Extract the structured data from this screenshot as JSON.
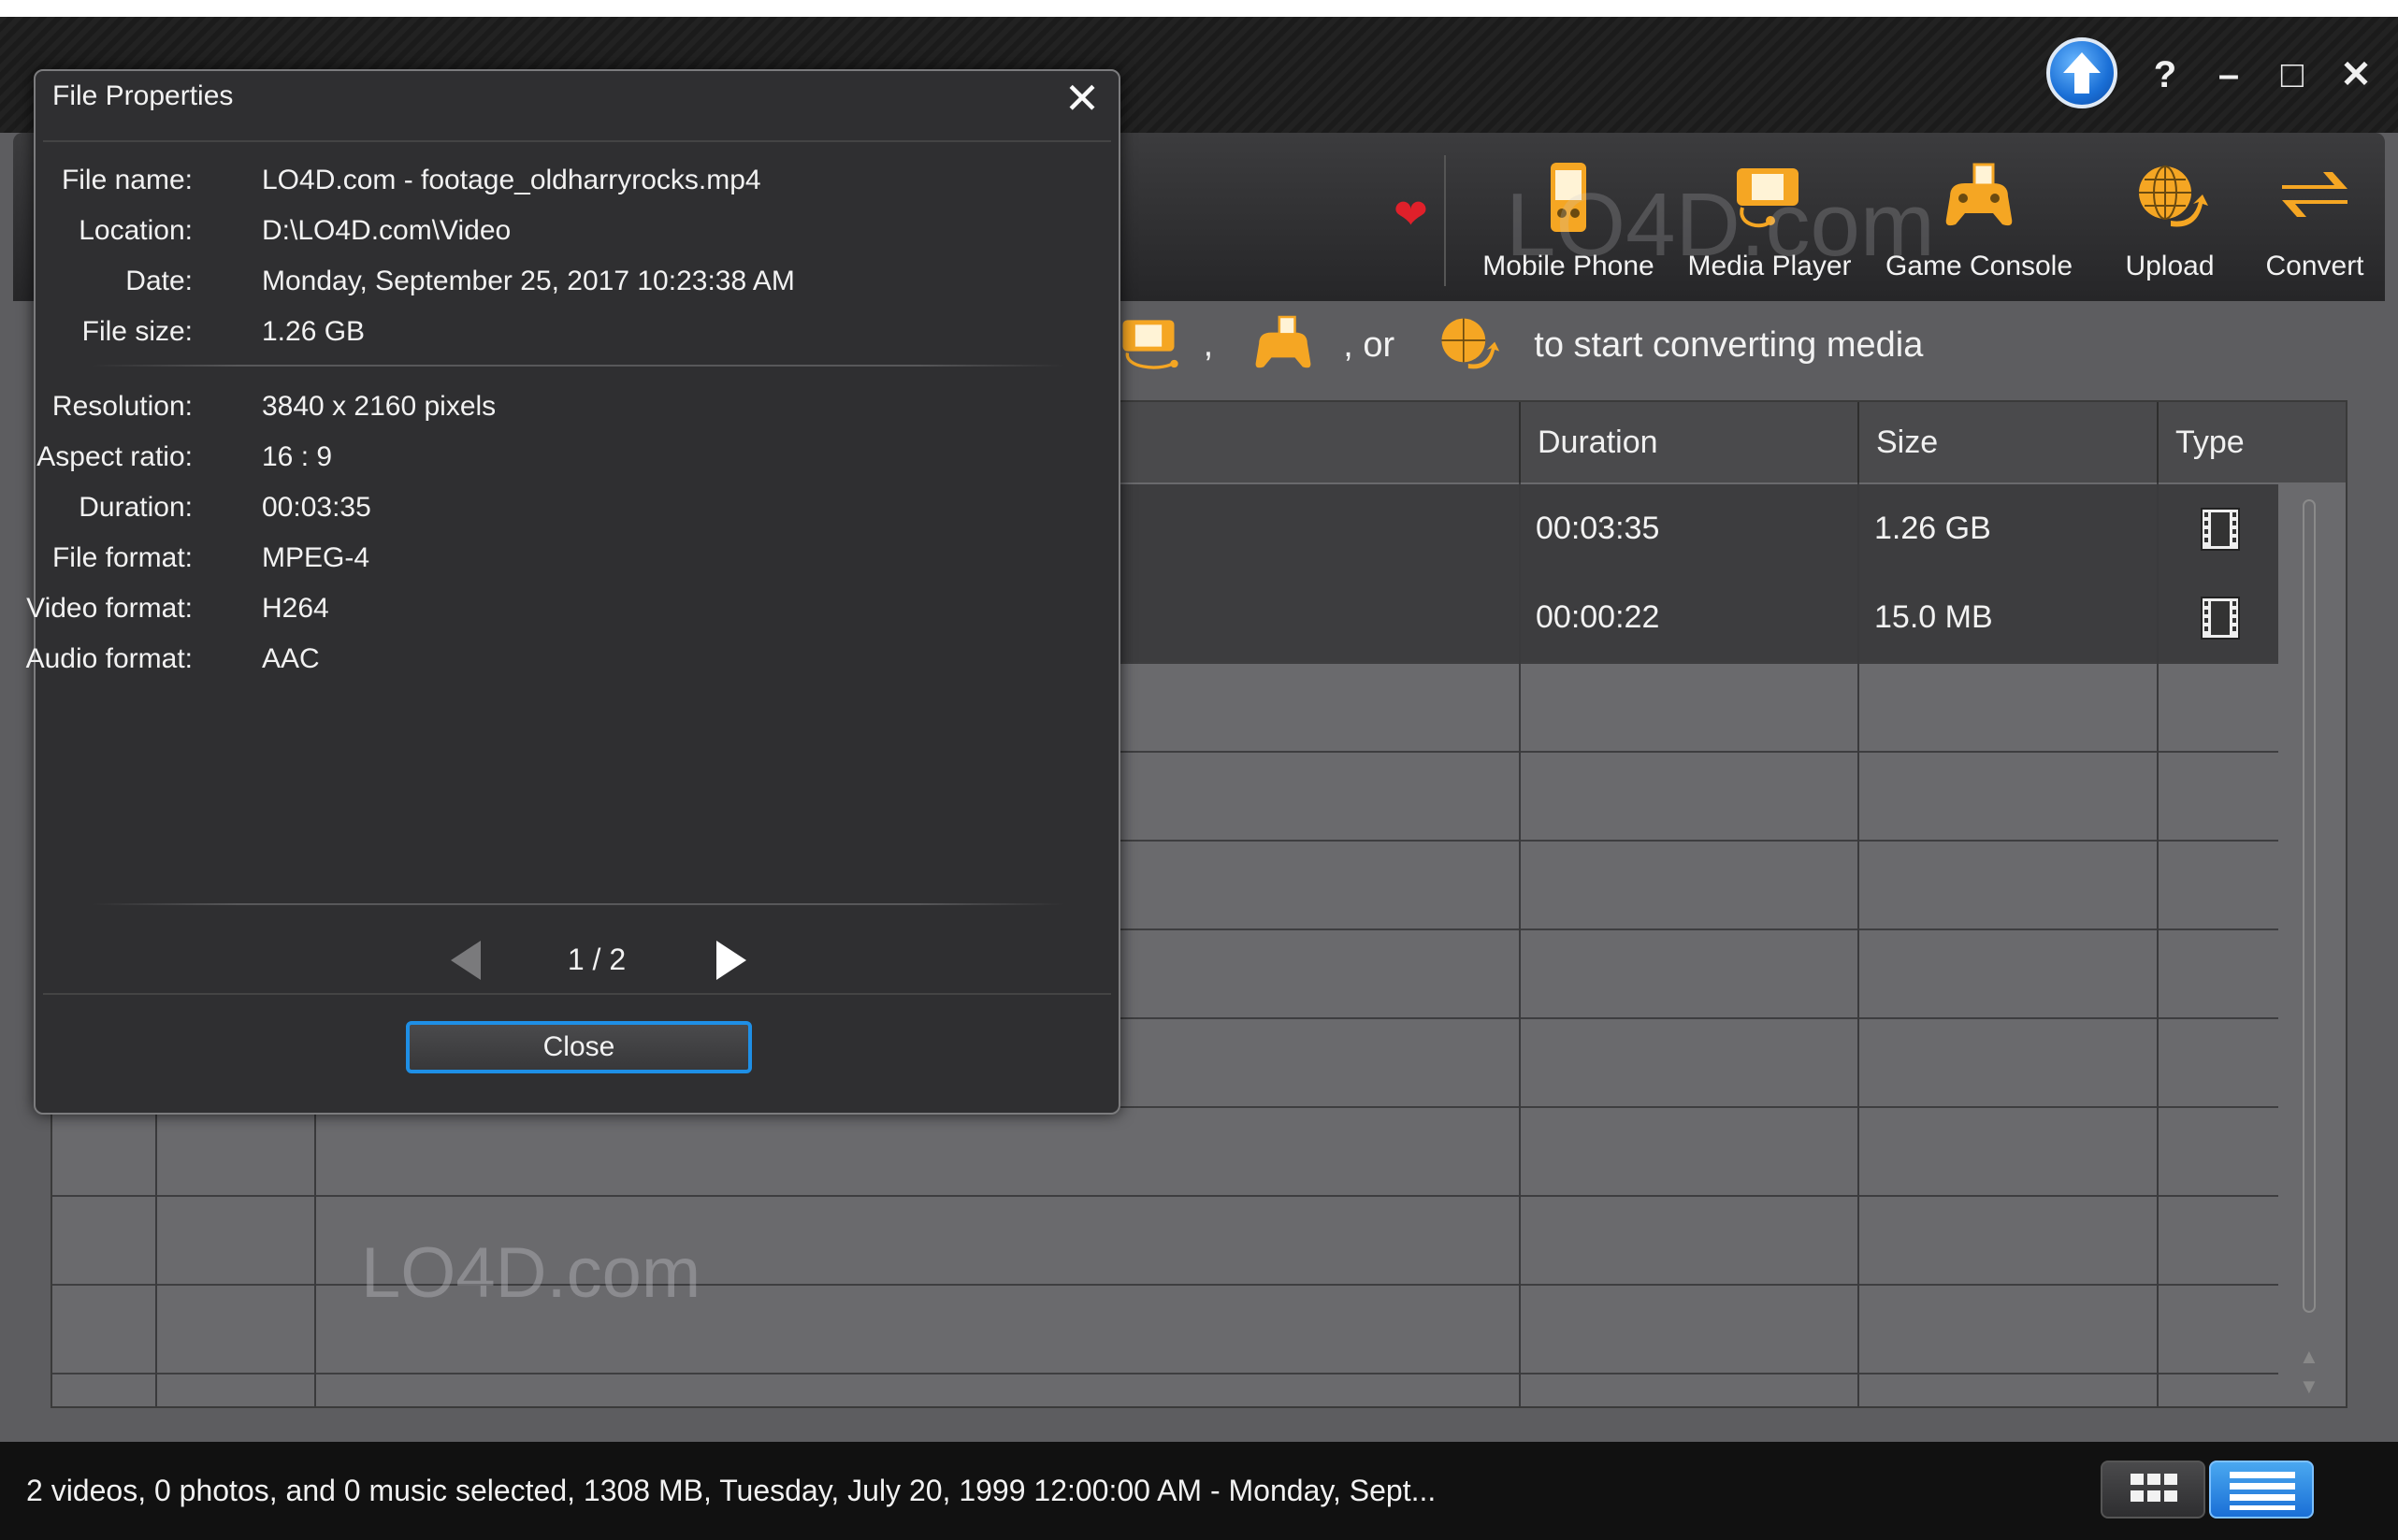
{
  "window": {
    "controls": {
      "help": "?",
      "minimize": "–",
      "maximize": "□",
      "close": "✕"
    }
  },
  "toolbar": {
    "items": [
      {
        "label": "Mobile Phone",
        "icon": "mobile-phone-icon"
      },
      {
        "label": "Media Player",
        "icon": "media-player-icon"
      },
      {
        "label": "Game Console",
        "icon": "game-console-icon"
      },
      {
        "label": "Upload",
        "icon": "upload-globe-icon"
      },
      {
        "label": "Convert",
        "icon": "convert-arrows-icon"
      }
    ],
    "favorite_icon": "heart-icon"
  },
  "hint": {
    "comma": ",",
    "or": ", or",
    "text": "to start converting media"
  },
  "table": {
    "columns": [
      "Duration",
      "Size",
      "Type"
    ],
    "rows": [
      {
        "duration": "00:03:35",
        "size": "1.26 GB",
        "type_icon": "film-strip-icon"
      },
      {
        "duration": "00:00:22",
        "size": "15.0 MB",
        "type_icon": "film-strip-icon"
      }
    ]
  },
  "watermark": "LO4D.com",
  "status": {
    "text": "2 videos, 0 photos, and 0 music selected, 1308 MB, Tuesday, July 20, 1999 12:00:00 AM - Monday, Sept..."
  },
  "dialog": {
    "title": "File Properties",
    "close_glyph": "✕",
    "properties": [
      {
        "key": "File name:",
        "value": "LO4D.com - footage_oldharryrocks.mp4"
      },
      {
        "key": "Location:",
        "value": "D:\\LO4D.com\\Video"
      },
      {
        "key": "Date:",
        "value": "Monday, September 25, 2017 10:23:38 AM"
      },
      {
        "key": "File size:",
        "value": "1.26 GB"
      }
    ],
    "media_properties": [
      {
        "key": "Resolution:",
        "value": "3840 x 2160 pixels"
      },
      {
        "key": "Aspect ratio:",
        "value": "16 : 9"
      },
      {
        "key": "Duration:",
        "value": "00:03:35"
      },
      {
        "key": "File format:",
        "value": "MPEG-4"
      },
      {
        "key": "Video format:",
        "value": "H264"
      },
      {
        "key": "Audio format:",
        "value": "AAC"
      }
    ],
    "page": "1 / 2",
    "close_button": "Close"
  },
  "colors": {
    "accent": "#f5a623",
    "button_focus": "#1e8fe6",
    "update_blue": "#1a6fd6"
  }
}
